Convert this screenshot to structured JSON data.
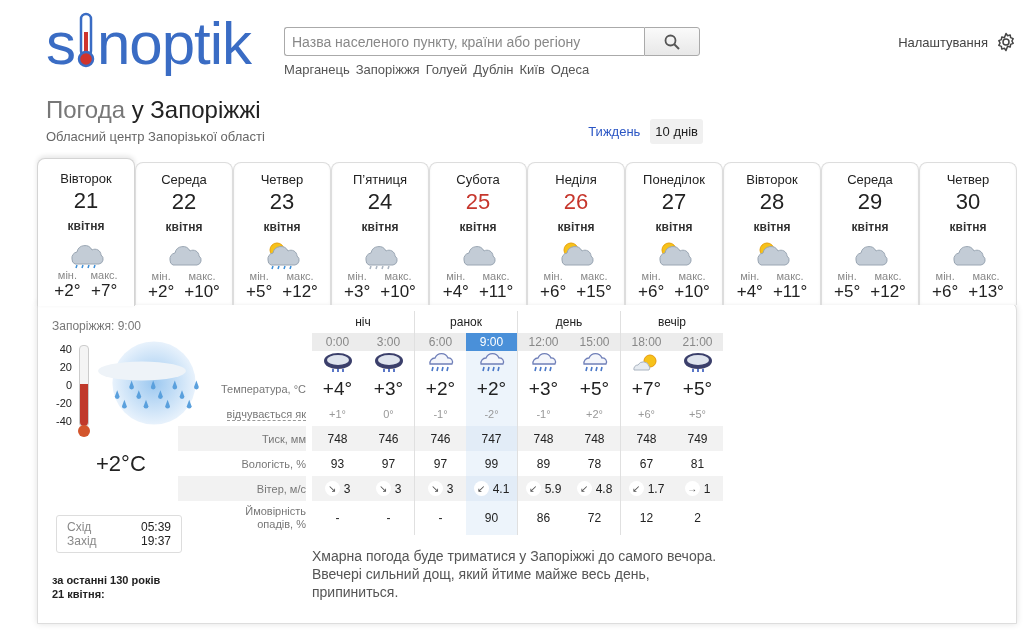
{
  "logo": {
    "start": "s",
    "end": "noptik"
  },
  "search": {
    "placeholder": "Назва населеного пункту, країни або регіону"
  },
  "quick_links": [
    "Марганець",
    "Запоріжжя",
    "Голуей",
    "Дублін",
    "Київ",
    "Одеса"
  ],
  "settings": {
    "label": "Налаштування"
  },
  "heading": {
    "prefix": "Погода",
    "city": "у Запоріжжі",
    "subtitle": "Обласний центр Запорізької області"
  },
  "range_tabs": [
    {
      "label": "Тиждень",
      "selected": false
    },
    {
      "label": "10 днів",
      "selected": true
    }
  ],
  "days": [
    {
      "weekday": "Вівторок",
      "date": "21",
      "month": "квітня",
      "kind": "rain",
      "min_label": "мін.",
      "min": "+2°",
      "max_label": "макс.",
      "max": "+7°",
      "selected": true,
      "weekend": false
    },
    {
      "weekday": "Середа",
      "date": "22",
      "month": "квітня",
      "kind": "cloud",
      "min_label": "мін.",
      "min": "+2°",
      "max_label": "макс.",
      "max": "+10°",
      "selected": false,
      "weekend": false
    },
    {
      "weekday": "Четвер",
      "date": "23",
      "month": "квітня",
      "kind": "sun-rain",
      "min_label": "мін.",
      "min": "+5°",
      "max_label": "макс.",
      "max": "+12°",
      "selected": false,
      "weekend": false
    },
    {
      "weekday": "П’ятниця",
      "date": "24",
      "month": "квітня",
      "kind": "drizzle",
      "min_label": "мін.",
      "min": "+3°",
      "max_label": "макс.",
      "max": "+10°",
      "selected": false,
      "weekend": false
    },
    {
      "weekday": "Субота",
      "date": "25",
      "month": "квітня",
      "kind": "cloud",
      "min_label": "мін.",
      "min": "+4°",
      "max_label": "макс.",
      "max": "+11°",
      "selected": false,
      "weekend": true
    },
    {
      "weekday": "Неділя",
      "date": "26",
      "month": "квітня",
      "kind": "sun-cloud",
      "min_label": "мін.",
      "min": "+6°",
      "max_label": "макс.",
      "max": "+15°",
      "selected": false,
      "weekend": true
    },
    {
      "weekday": "Понеділок",
      "date": "27",
      "month": "квітня",
      "kind": "sun-cloud",
      "min_label": "мін.",
      "min": "+6°",
      "max_label": "макс.",
      "max": "+10°",
      "selected": false,
      "weekend": false
    },
    {
      "weekday": "Вівторок",
      "date": "28",
      "month": "квітня",
      "kind": "sun-cloud",
      "min_label": "мін.",
      "min": "+4°",
      "max_label": "макс.",
      "max": "+11°",
      "selected": false,
      "weekend": false
    },
    {
      "weekday": "Середа",
      "date": "29",
      "month": "квітня",
      "kind": "cloud",
      "min_label": "мін.",
      "min": "+5°",
      "max_label": "макс.",
      "max": "+12°",
      "selected": false,
      "weekend": false
    },
    {
      "weekday": "Четвер",
      "date": "30",
      "month": "квітня",
      "kind": "cloud",
      "min_label": "мін.",
      "min": "+6°",
      "max_label": "макс.",
      "max": "+13°",
      "selected": false,
      "weekend": false
    }
  ],
  "now": {
    "place_time": "Запоріжжя: 9:00",
    "scale": [
      "40",
      "20",
      "0",
      "-20",
      "-40"
    ],
    "level": 0.52,
    "temperature": "+2°C",
    "sun": [
      {
        "label": "Схід",
        "time": "05:39"
      },
      {
        "label": "Захід",
        "time": "19:37"
      }
    ],
    "history": "за останні 130 років\n21 квітня:"
  },
  "row_labels": {
    "temperature": "Температура, °C",
    "feels": "відчувається як",
    "pressure": "Тиск, мм",
    "humidity": "Вологість, %",
    "wind": "Вітер, м/с",
    "precip": "Ймовірність опадів, %"
  },
  "periods": [
    {
      "name": "ніч",
      "hours": [
        {
          "time": "0:00",
          "selected": false,
          "kind": "storm",
          "temp": "+4°",
          "feels": "+1°",
          "pressure": "748",
          "humidity": "93",
          "wind_arrow": "↘",
          "wind": "3",
          "precip": "-"
        },
        {
          "time": "3:00",
          "selected": false,
          "kind": "storm",
          "temp": "+3°",
          "feels": "0°",
          "pressure": "746",
          "humidity": "97",
          "wind_arrow": "↘",
          "wind": "3",
          "precip": "-"
        }
      ]
    },
    {
      "name": "ранок",
      "hours": [
        {
          "time": "6:00",
          "selected": false,
          "kind": "rain",
          "temp": "+2°",
          "feels": "-1°",
          "pressure": "746",
          "humidity": "97",
          "wind_arrow": "↘",
          "wind": "3",
          "precip": "-"
        },
        {
          "time": "9:00",
          "selected": true,
          "kind": "rain",
          "temp": "+2°",
          "feels": "-2°",
          "pressure": "747",
          "humidity": "99",
          "wind_arrow": "↙",
          "wind": "4.1",
          "precip": "90"
        }
      ]
    },
    {
      "name": "день",
      "hours": [
        {
          "time": "12:00",
          "selected": false,
          "kind": "rain",
          "temp": "+3°",
          "feels": "-1°",
          "pressure": "748",
          "humidity": "89",
          "wind_arrow": "↙",
          "wind": "5.9",
          "precip": "86"
        },
        {
          "time": "15:00",
          "selected": false,
          "kind": "rain",
          "temp": "+5°",
          "feels": "+2°",
          "pressure": "748",
          "humidity": "78",
          "wind_arrow": "↙",
          "wind": "4.8",
          "precip": "72"
        }
      ]
    },
    {
      "name": "вечір",
      "hours": [
        {
          "time": "18:00",
          "selected": false,
          "kind": "sun-cloud",
          "temp": "+7°",
          "feels": "+6°",
          "pressure": "748",
          "humidity": "67",
          "wind_arrow": "↙",
          "wind": "1.7",
          "precip": "12"
        },
        {
          "time": "21:00",
          "selected": false,
          "kind": "storm",
          "temp": "+5°",
          "feels": "+5°",
          "pressure": "749",
          "humidity": "81",
          "wind_arrow": "→",
          "wind": "1",
          "precip": "2"
        }
      ]
    }
  ],
  "description": "Хмарна погода буде триматися у Запоріжжі до самого вечора. Ввечері сильний дощ, який йтиме майже весь день, припиниться."
}
